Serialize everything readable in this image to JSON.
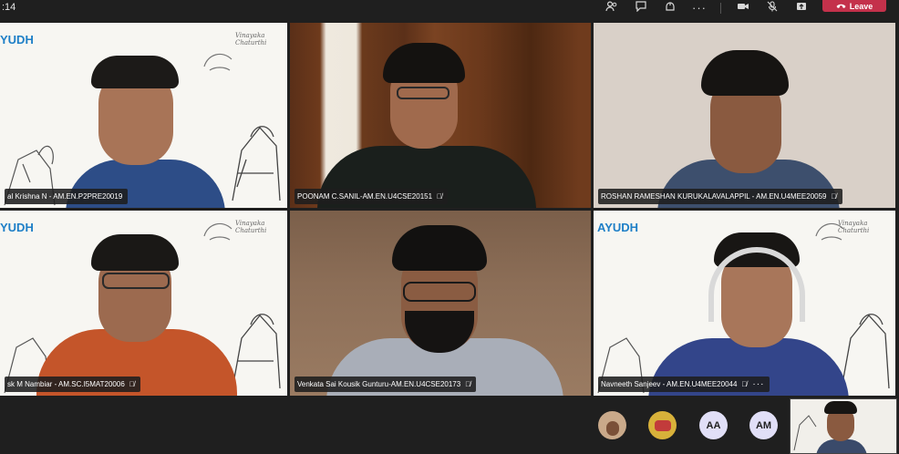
{
  "call": {
    "timer": ":14",
    "leave_label": "Leave"
  },
  "icons": {
    "people": "people-icon",
    "chat": "chat-icon",
    "reactions": "reactions-icon",
    "more": "more-options-icon",
    "camera": "camera-icon",
    "mic": "mic-icon",
    "share": "share-screen-icon",
    "leave": "phone-hangup-icon"
  },
  "participants": [
    {
      "name": "al Krishna N - AM.EN.P2PRE20019",
      "muted": false,
      "logo": "YUDH",
      "signature": "Vinayaka Chaturthi"
    },
    {
      "name": "POONAM C.SANIL-AM.EN.U4CSE20151",
      "muted": true
    },
    {
      "name": "ROSHAN RAMESHAN KURUKALAVALAPPIL - AM.EN.U4MEE20059",
      "muted": true
    },
    {
      "name": "sk M Nambiar - AM.SC.I5MAT20006",
      "muted": true,
      "logo": "YUDH",
      "signature": "Vinayaka Chaturthi"
    },
    {
      "name": "Venkata Sai Kousik Gunturu-AM.EN.U4CSE20173",
      "muted": true
    },
    {
      "name": "Navneeth Sanjeev - AM.EN.U4MEE20044",
      "muted": true,
      "more": "···",
      "logo": "AYUDH",
      "signature": "Vinayaka Chaturthi"
    }
  ],
  "overflow_avatars": [
    {
      "initials": "",
      "kind": "photo",
      "color": "#c9a98a"
    },
    {
      "initials": "",
      "kind": "cartoon",
      "color": "#d8b13a"
    },
    {
      "initials": "AA",
      "kind": "initials",
      "color": "#e1dff7"
    },
    {
      "initials": "AM",
      "kind": "initials",
      "color": "#e1dff7"
    }
  ],
  "colors": {
    "leave_red": "#c4314b",
    "background": "#1f1f1f",
    "logo_blue": "#1e7fc7"
  }
}
